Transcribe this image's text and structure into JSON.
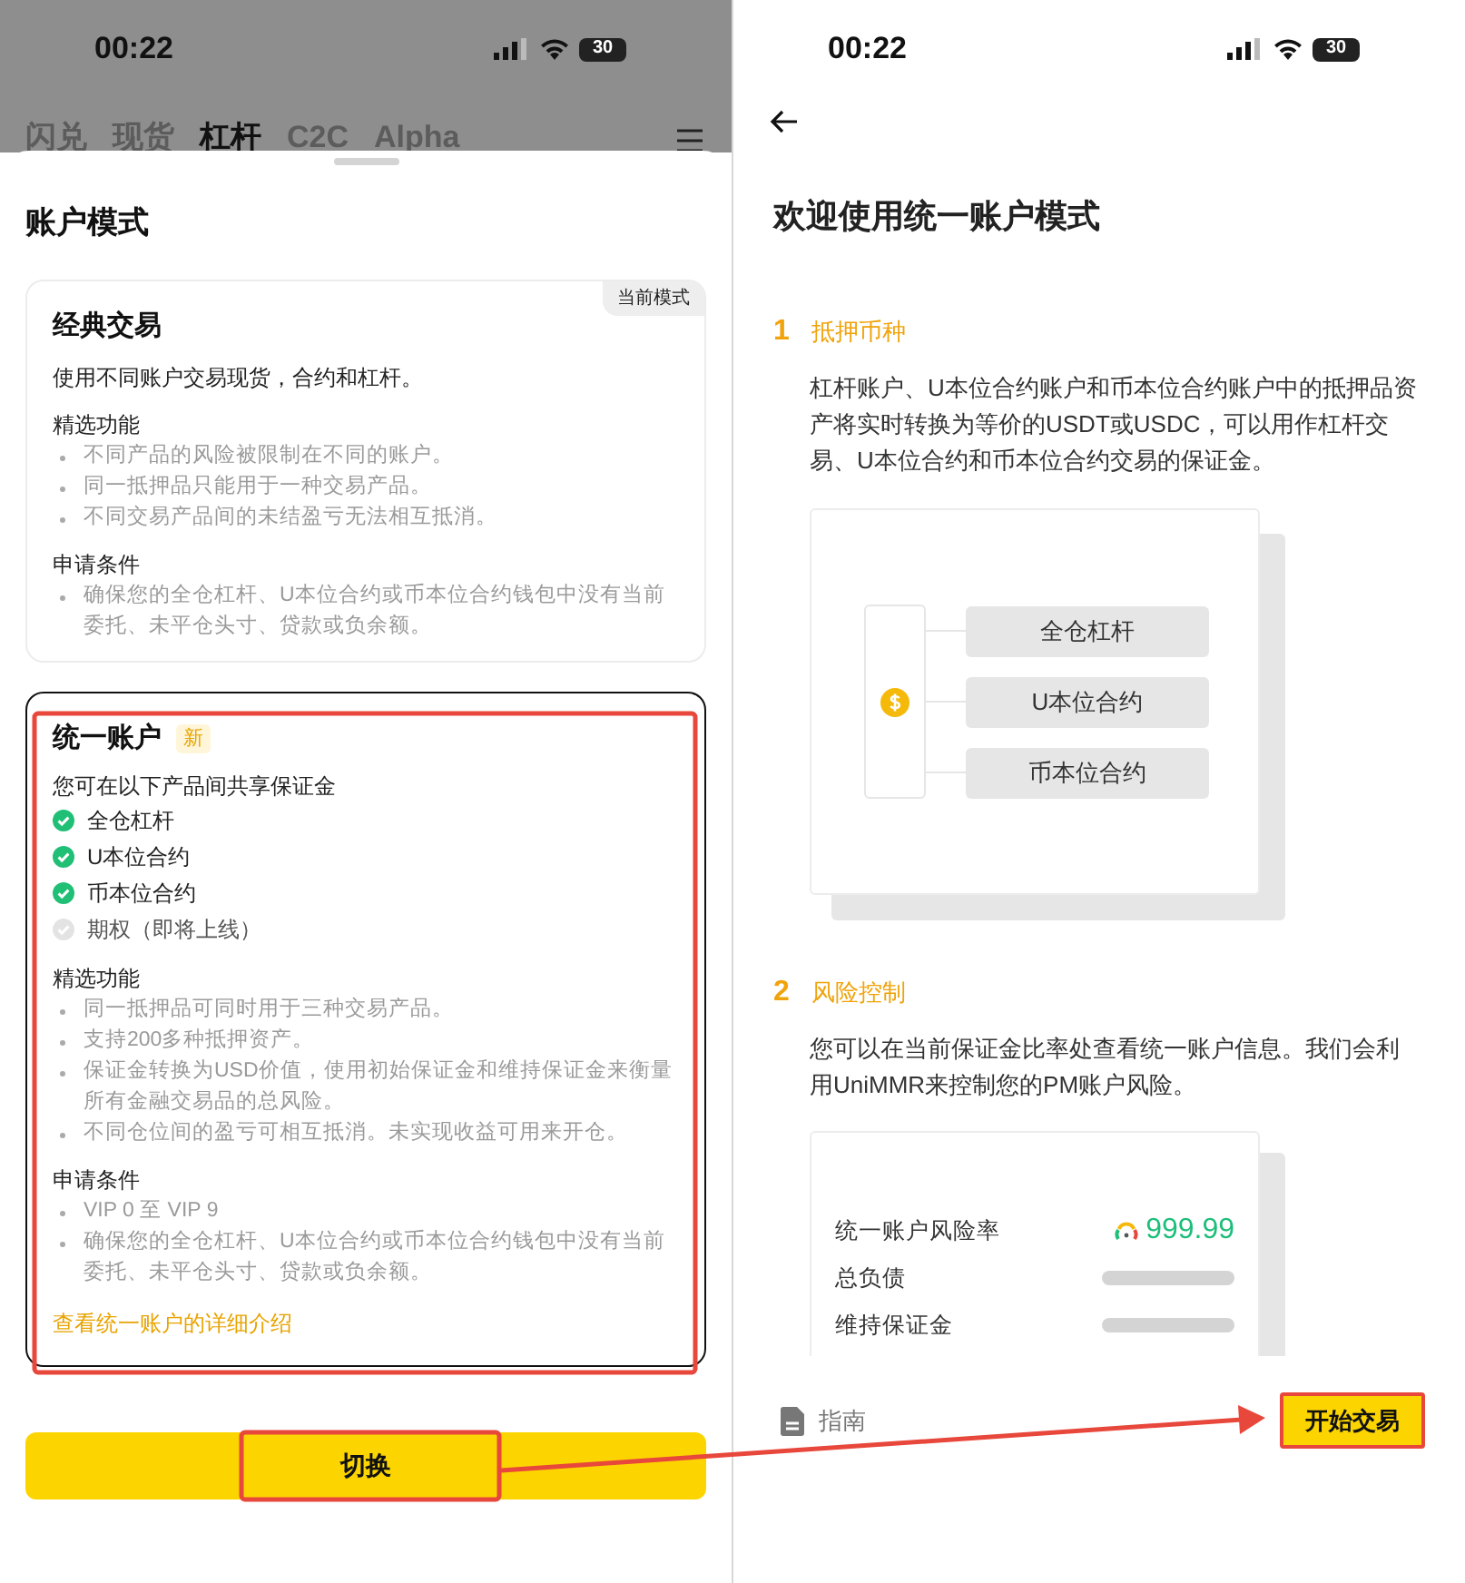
{
  "left": {
    "status_bar": {
      "time": "00:22",
      "battery": "30"
    },
    "tabs": [
      {
        "label": "闪兑",
        "selected": false
      },
      {
        "label": "现货",
        "selected": false
      },
      {
        "label": "杠杆",
        "selected": true
      },
      {
        "label": "C2C",
        "selected": false
      },
      {
        "label": "Alpha",
        "selected": false
      }
    ],
    "sheet": {
      "title": "账户模式",
      "modes": [
        {
          "title": "经典交易",
          "badge": "当前模式",
          "selected": false,
          "description": "使用不同账户交易现货，合约和杠杆。",
          "sections": [
            {
              "heading": "精选功能",
              "bullets": [
                "不同产品的风险被限制在不同的账户。",
                "同一抵押品只能用于一种交易产品。",
                "不同交易产品间的未结盈亏无法相互抵消。"
              ]
            },
            {
              "heading": "申请条件",
              "bullets": [
                "确保您的全仓杠杆、U本位合约或币本位合约钱包中没有当前委托、未平仓头寸、贷款或负余额。"
              ]
            }
          ]
        },
        {
          "title": "统一账户",
          "tag": "新",
          "selected": true,
          "intro": "您可在以下产品间共享保证金",
          "products": [
            {
              "label": "全仓杠杆",
              "available": true
            },
            {
              "label": "U本位合约",
              "available": true
            },
            {
              "label": "币本位合约",
              "available": true
            },
            {
              "label": "期权（即将上线）",
              "available": false
            }
          ],
          "sections": [
            {
              "heading": "精选功能",
              "bullets": [
                "同一抵押品可同时用于三种交易产品。",
                "支持200多种抵押资产。",
                "保证金转换为USD价值，使用初始保证金和维持保证金来衡量所有金融交易品的总风险。",
                "不同仓位间的盈亏可相互抵消。未实现收益可用来开仓。"
              ]
            },
            {
              "heading": "申请条件",
              "bullets": [
                "VIP 0 至 VIP 9",
                "确保您的全仓杠杆、U本位合约或币本位合约钱包中没有当前委托、未平仓头寸、贷款或负余额。"
              ]
            }
          ],
          "link": "查看统一账户的详细介绍"
        }
      ],
      "button": "切换"
    }
  },
  "right": {
    "status_bar": {
      "time": "00:22",
      "battery": "30"
    },
    "title": "欢迎使用统一账户模式",
    "steps": [
      {
        "number": "1",
        "heading": "抵押币种",
        "text": "杠杆账户、U本位合约账户和币本位合约账户中的抵押品资产将实时转换为等价的USDT或USDC，可以用作杠杆交易、U本位合约和币本位合约交易的保证金。",
        "diagram_items": [
          "全仓杠杆",
          "U本位合约",
          "币本位合约"
        ]
      },
      {
        "number": "2",
        "heading": "风险控制",
        "text": "您可以在当前保证金比率处查看统一账户信息。我们会利用UniMMR来控制您的PM账户风险。",
        "risk_rows": [
          {
            "label": "统一账户风险率",
            "value": "999.99"
          },
          {
            "label": "总负债"
          },
          {
            "label": "维持保证金"
          }
        ]
      }
    ],
    "footer": {
      "guide": "指南",
      "button": "开始交易"
    }
  }
}
